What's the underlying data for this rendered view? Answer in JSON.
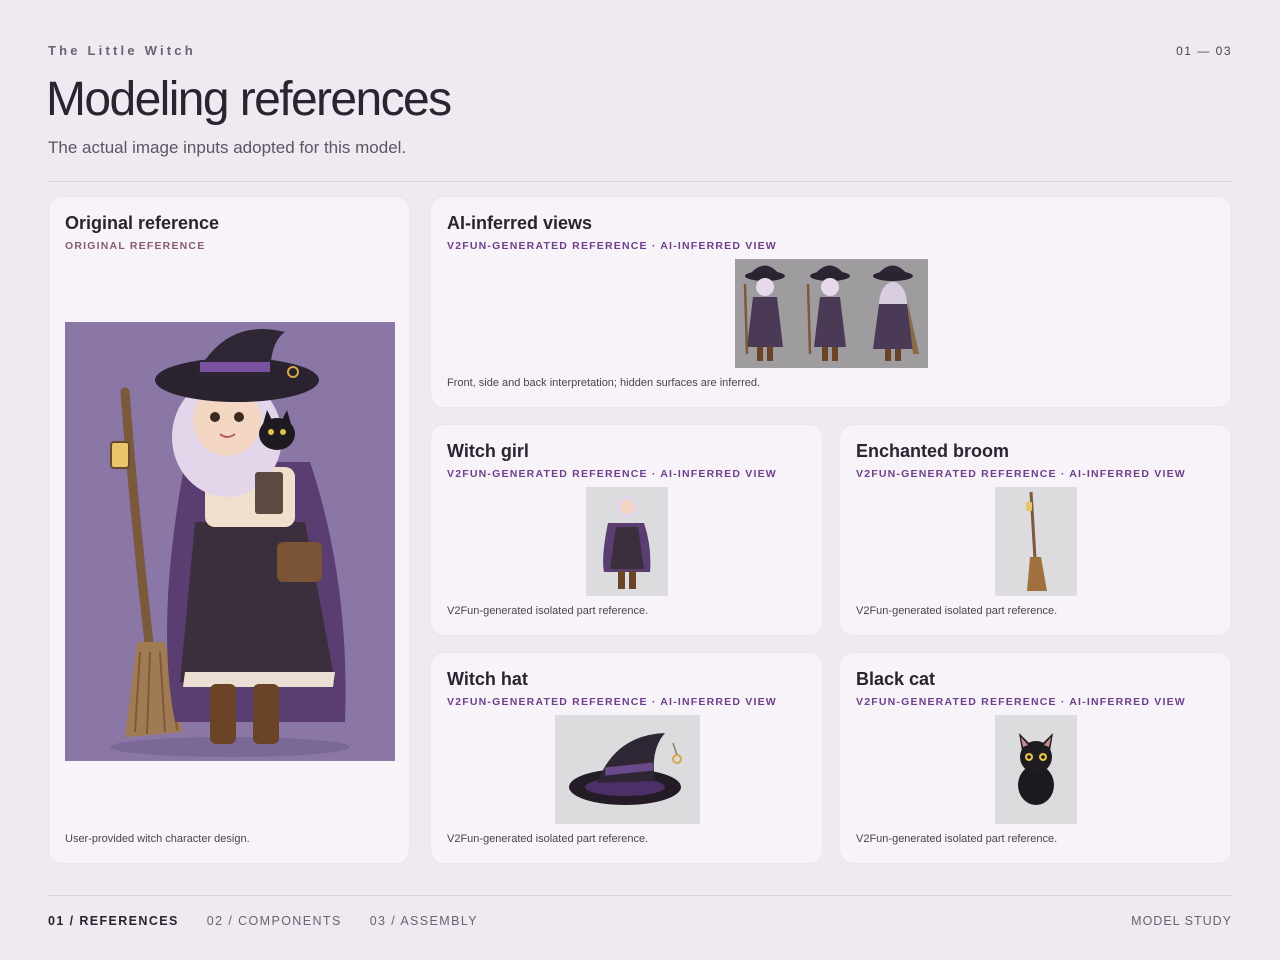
{
  "header": {
    "project": "The Little Witch",
    "counter": "01 — 03",
    "title": "Modeling references",
    "subtitle": "The actual image inputs adopted for this model."
  },
  "cards": {
    "original": {
      "title": "Original reference",
      "tag": "ORIGINAL REFERENCE",
      "caption": "User-provided witch character design."
    },
    "views": {
      "title": "AI-inferred views",
      "tag": "V2FUN-GENERATED REFERENCE · AI-INFERRED VIEW",
      "caption": "Front, side and back interpretation; hidden surfaces are inferred."
    },
    "girl": {
      "title": "Witch girl",
      "tag": "V2FUN-GENERATED REFERENCE · AI-INFERRED VIEW",
      "caption": "V2Fun-generated isolated part reference."
    },
    "broom": {
      "title": "Enchanted broom",
      "tag": "V2FUN-GENERATED REFERENCE · AI-INFERRED VIEW",
      "caption": "V2Fun-generated isolated part reference."
    },
    "hat": {
      "title": "Witch hat",
      "tag": "V2FUN-GENERATED REFERENCE · AI-INFERRED VIEW",
      "caption": "V2Fun-generated isolated part reference."
    },
    "cat": {
      "title": "Black cat",
      "tag": "V2FUN-GENERATED REFERENCE · AI-INFERRED VIEW",
      "caption": "V2Fun-generated isolated part reference."
    }
  },
  "footer": {
    "nav": [
      "01 / REFERENCES",
      "02 / COMPONENTS",
      "03 / ASSEMBLY"
    ],
    "active_index": 0,
    "right": "MODEL STUDY"
  },
  "colors": {
    "background": "#efe9f1",
    "card": "#f7f3f8",
    "accent": "#6e3f8c",
    "original_bg": "#8a77a6"
  }
}
